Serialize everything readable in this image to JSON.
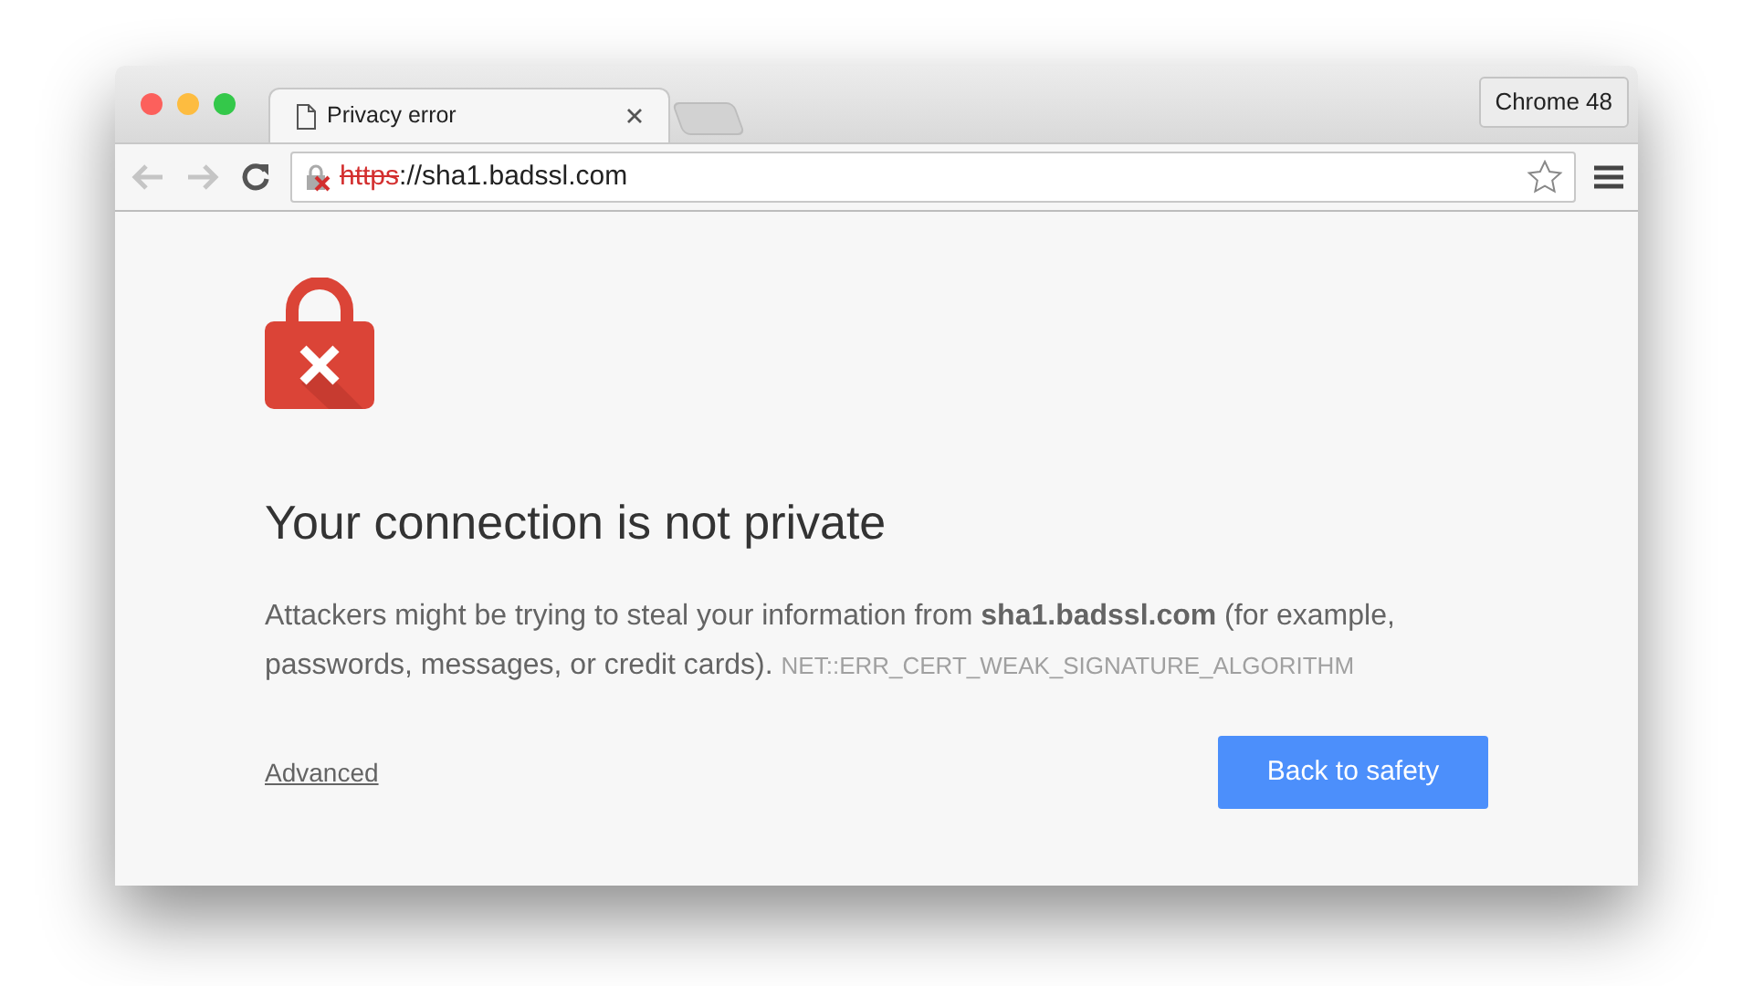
{
  "tabs": [
    {
      "label": "Privacy error",
      "selected": true
    }
  ],
  "profile_button": "Chrome 48",
  "address_bar": {
    "scheme": "https",
    "rest": "://sha1.badssl.com",
    "insecure": true
  },
  "page": {
    "heading": "Your connection is not private",
    "message": "Attackers might be trying to steal your information from **sha1.badssl.com** (for example, passwords, messages, or credit cards).",
    "error_code": "NET::ERR_CERT_WEAK_SIGNATURE_ALGORITHM",
    "advanced_link": "Advanced",
    "primary_button": "Back to safety"
  }
}
